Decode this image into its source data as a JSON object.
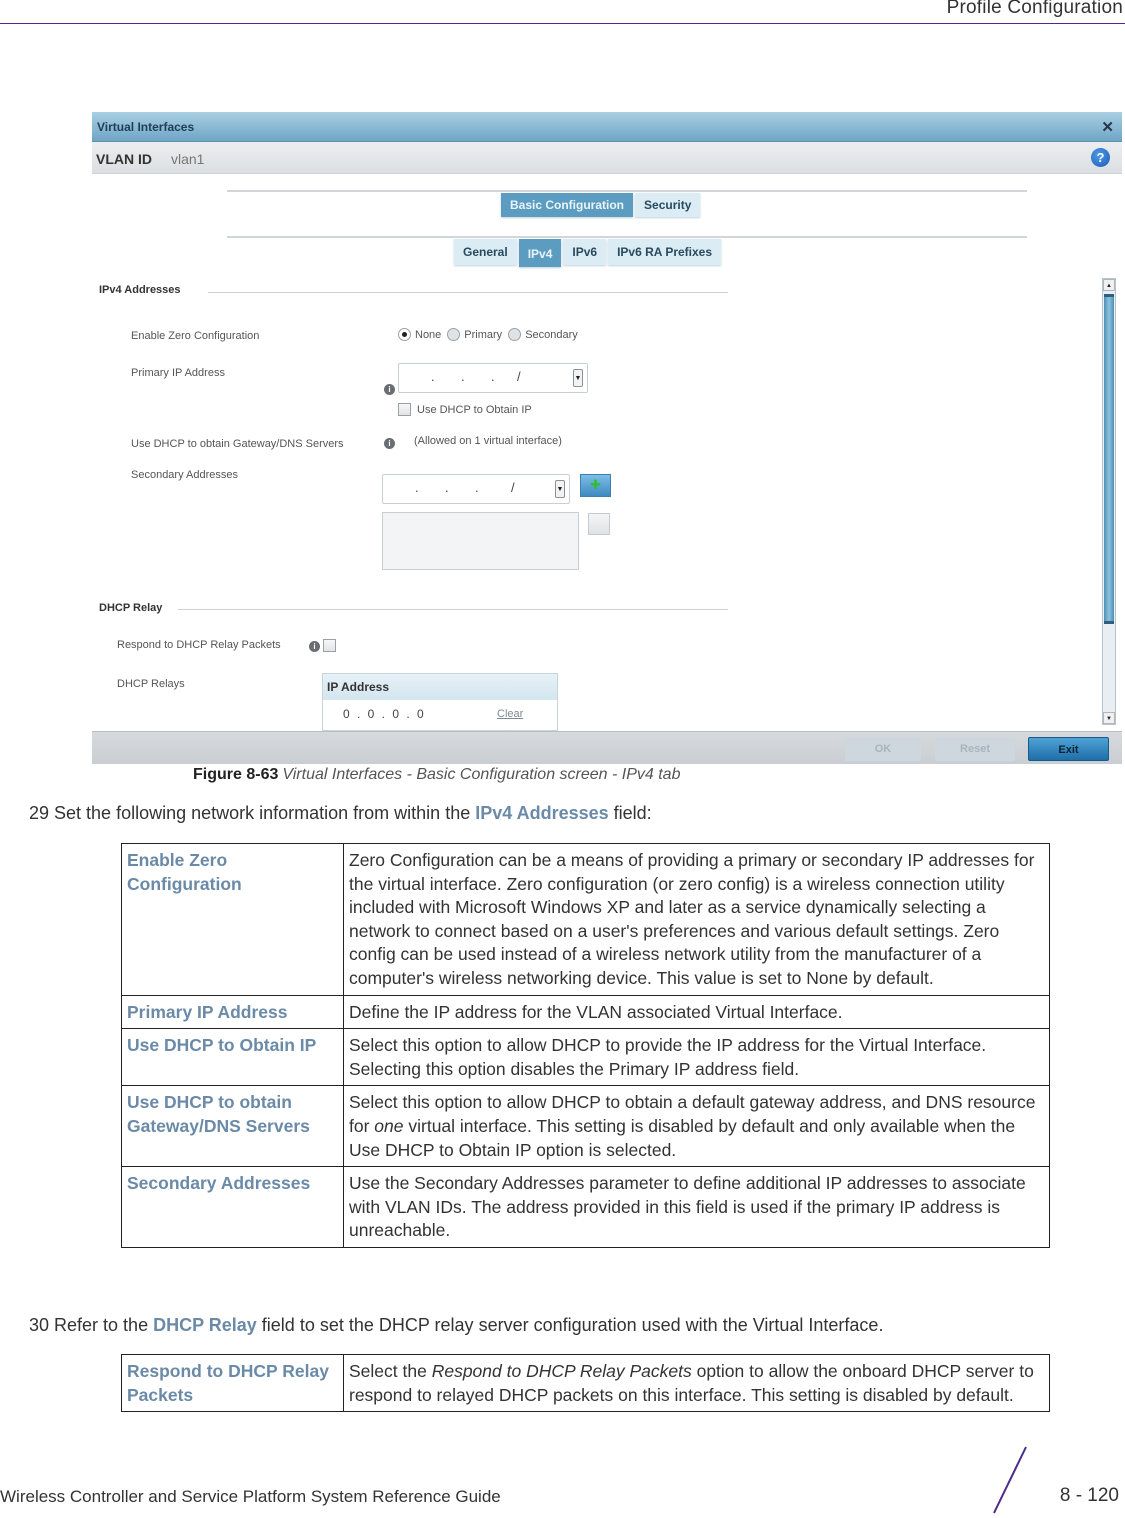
{
  "page_header": {
    "title": "Profile Configuration"
  },
  "screenshot": {
    "dialog_title": "Virtual Interfaces",
    "close_icon": "close-icon",
    "help_icon": "help-icon",
    "vlan_label": "VLAN ID",
    "vlan_value": "vlan1",
    "top_tabs": [
      {
        "label": "Basic Configuration",
        "active": true
      },
      {
        "label": "Security",
        "active": false
      }
    ],
    "sub_tabs": [
      {
        "label": "General",
        "active": false
      },
      {
        "label": "IPv4",
        "active": true
      },
      {
        "label": "IPv6",
        "active": false
      },
      {
        "label": "IPv6 RA Prefixes",
        "active": false
      }
    ],
    "ipv4_section": {
      "heading": "IPv4 Addresses",
      "zero_config": {
        "label": "Enable Zero Configuration",
        "options": [
          "None",
          "Primary",
          "Secondary"
        ],
        "selected": "None"
      },
      "primary_ip": {
        "label": "Primary IP Address",
        "value": ".  .  .  /"
      },
      "use_dhcp_obtain_ip": {
        "label": "Use DHCP to Obtain IP",
        "checked": false
      },
      "dhcp_gateway": {
        "label": "Use DHCP to obtain Gateway/DNS Servers",
        "note": "(Allowed on 1 virtual interface)"
      },
      "secondary": {
        "label": "Secondary Addresses",
        "value": ".  .  .  /"
      }
    },
    "dhcp_relay_section": {
      "heading": "DHCP Relay",
      "respond_label": "Respond to DHCP Relay Packets",
      "respond_checked": false,
      "relays_label": "DHCP Relays",
      "table_header": "IP Address",
      "rows": [
        {
          "ip": "0 . 0 . 0 . 0",
          "action": "Clear"
        }
      ]
    },
    "buttons": {
      "ok": "OK",
      "reset": "Reset",
      "exit": "Exit"
    }
  },
  "caption": {
    "label": "Figure 8-63",
    "text": "Virtual Interfaces - Basic Configuration screen - IPv4 tab"
  },
  "step29": {
    "prefix": "29 Set the following network information from within the ",
    "keyword": "IPv4 Addresses",
    "suffix": " field:"
  },
  "table1": [
    {
      "term": "Enable Zero Configuration",
      "definition": "Zero Configuration can be a means of providing a primary or secondary IP addresses for the virtual interface. Zero configuration (or zero config) is a wireless connection utility included with Microsoft Windows XP and later as a service dynamically selecting a network to connect based on a user's preferences and various default settings. Zero config can be used instead of a wireless network utility from the manufacturer of a computer's wireless networking device. This value is set to None by default."
    },
    {
      "term": "Primary IP Address",
      "definition": "Define the IP address for the VLAN associated Virtual Interface."
    },
    {
      "term": "Use DHCP to Obtain IP",
      "definition": "Select this option to allow DHCP to provide the IP address for the Virtual Interface. Selecting this option disables the Primary IP address field."
    },
    {
      "term": "Use DHCP to obtain Gateway/DNS Servers",
      "definition_pre": "Select this option to allow DHCP to obtain a default gateway address, and DNS resource for ",
      "definition_em": "one",
      "definition_post": " virtual interface. This setting is disabled by default and only available when the Use DHCP to Obtain IP option is selected."
    },
    {
      "term": "Secondary Addresses",
      "definition": "Use the Secondary Addresses parameter to define additional IP addresses to associate with VLAN IDs. The address provided in this field is used if the primary IP address is unreachable."
    }
  ],
  "step30": {
    "prefix": "30 Refer to the ",
    "keyword": "DHCP Relay",
    "suffix": " field to set the DHCP relay server configuration used with the Virtual Interface."
  },
  "table2": [
    {
      "term": "Respond to DHCP Relay Packets",
      "definition_pre": "Select the ",
      "definition_em": "Respond to DHCP Relay Packets",
      "definition_post": " option to allow the onboard DHCP server to respond to relayed DHCP packets on this interface. This setting is disabled by default."
    }
  ],
  "page_footer": {
    "guide_title": "Wireless Controller and Service Platform System Reference Guide",
    "page_number": "8 - 120"
  },
  "colors": {
    "accent_rule": "#4b2a8a",
    "keyword": "#6a8aa8",
    "active_tab": "#5c9cc0"
  }
}
